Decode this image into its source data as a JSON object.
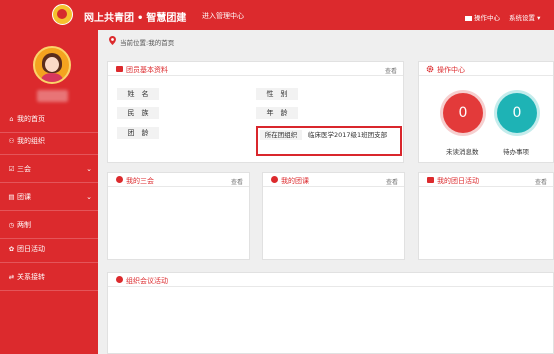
{
  "header": {
    "app_title": "网上共青团",
    "separator": "•",
    "app_subtitle": "智慧团建",
    "admin_link": "进入管理中心",
    "ops_link": "操作中心",
    "settings_link": "系统设置 ▾"
  },
  "sidebar": {
    "items": [
      {
        "icon": "home-icon",
        "label": "我的首页"
      },
      {
        "icon": "org-icon",
        "label": "我的组织"
      },
      {
        "icon": "check-square-icon",
        "label": "三会",
        "chevron": "⌄"
      },
      {
        "icon": "book-icon",
        "label": "团课",
        "chevron": "⌄"
      },
      {
        "icon": "clock-icon",
        "label": "两制"
      },
      {
        "icon": "gift-icon",
        "label": "团日活动"
      },
      {
        "icon": "transfer-icon",
        "label": "关系接转"
      }
    ]
  },
  "breadcrumb": "当前位置:我的首页",
  "member_info": {
    "title": "团员基本资料",
    "view": "查看",
    "fields": {
      "name": "姓　名",
      "gender": "性　别",
      "ethnicity": "民　族",
      "age": "年　龄",
      "league_age": "团　龄",
      "org_label": "所在团组织",
      "org_value": "临床医学2017级1班团支部"
    }
  },
  "ops_center": {
    "title": "操作中心",
    "unread_count": "0",
    "unread_label": "未读消息数",
    "todo_count": "0",
    "todo_label": "待办事项"
  },
  "panels": {
    "three_meetings": {
      "title": "我的三会",
      "view": "查看"
    },
    "league_class": {
      "title": "我的团课",
      "view": "查看"
    },
    "league_day": {
      "title": "我的团日活动",
      "view": "查看"
    },
    "org_meeting": {
      "title": "组织会议活动"
    }
  },
  "colors": {
    "brand_red": "#dc2a2d",
    "teal": "#1eb3b5"
  }
}
